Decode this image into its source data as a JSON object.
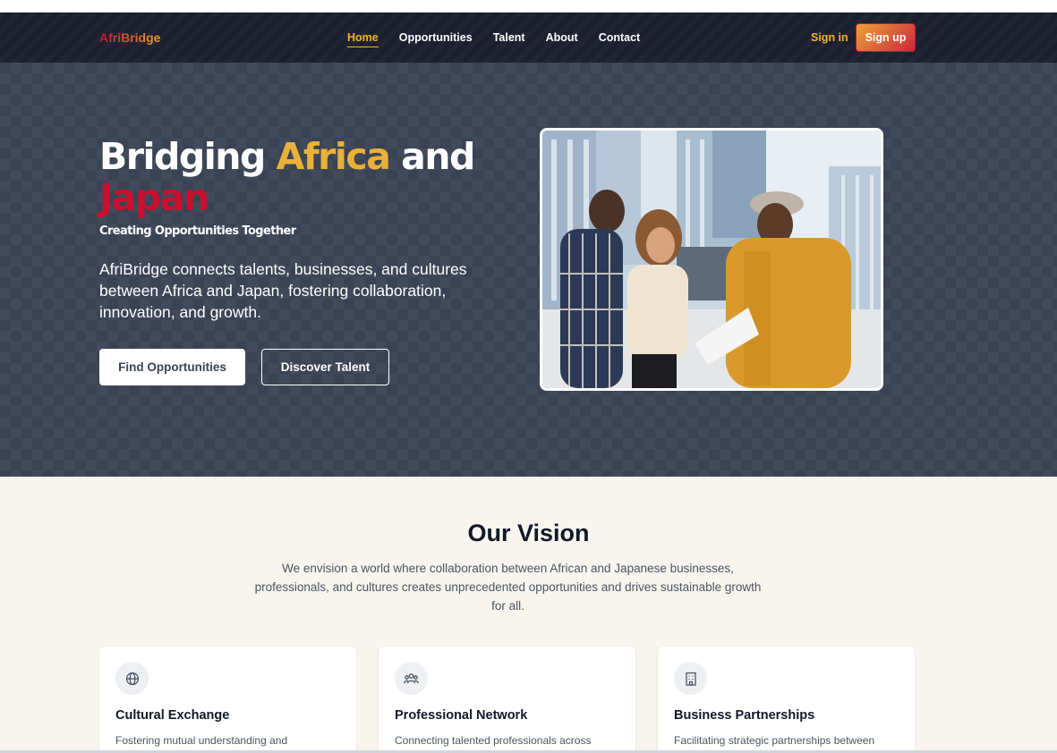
{
  "nav": {
    "logo": "AfriBridge",
    "links": [
      "Home",
      "Opportunities",
      "Talent",
      "About",
      "Contact"
    ],
    "signin": "Sign in",
    "signup": "Sign up"
  },
  "hero": {
    "title_part1": "Bridging ",
    "title_africa": "Africa",
    "title_part2": " and",
    "title_japan": "Japan",
    "subtitle": "Creating Opportunities Together",
    "description": "AfriBridge connects talents, businesses, and cultures between Africa and Japan, fostering collaboration, innovation, and growth.",
    "btn_find": "Find Opportunities",
    "btn_discover": "Discover Talent"
  },
  "vision": {
    "title": "Our Vision",
    "description": "We envision a world where collaboration between African and Japanese businesses, professionals, and cultures creates unprecedented opportunities and drives sustainable growth for all.",
    "cards": [
      {
        "icon": "globe-icon",
        "title": "Cultural Exchange",
        "text": "Fostering mutual understanding and"
      },
      {
        "icon": "users-icon",
        "title": "Professional Network",
        "text": "Connecting talented professionals across"
      },
      {
        "icon": "building-icon",
        "title": "Business Partnerships",
        "text": "Facilitating strategic partnerships between"
      }
    ]
  },
  "colors": {
    "brand_red": "#c8102e",
    "brand_gold": "#eab13a",
    "nav_bg": "#1c1f2e",
    "hero_bg": "#3a4354",
    "vision_bg": "#f8f5ee"
  }
}
